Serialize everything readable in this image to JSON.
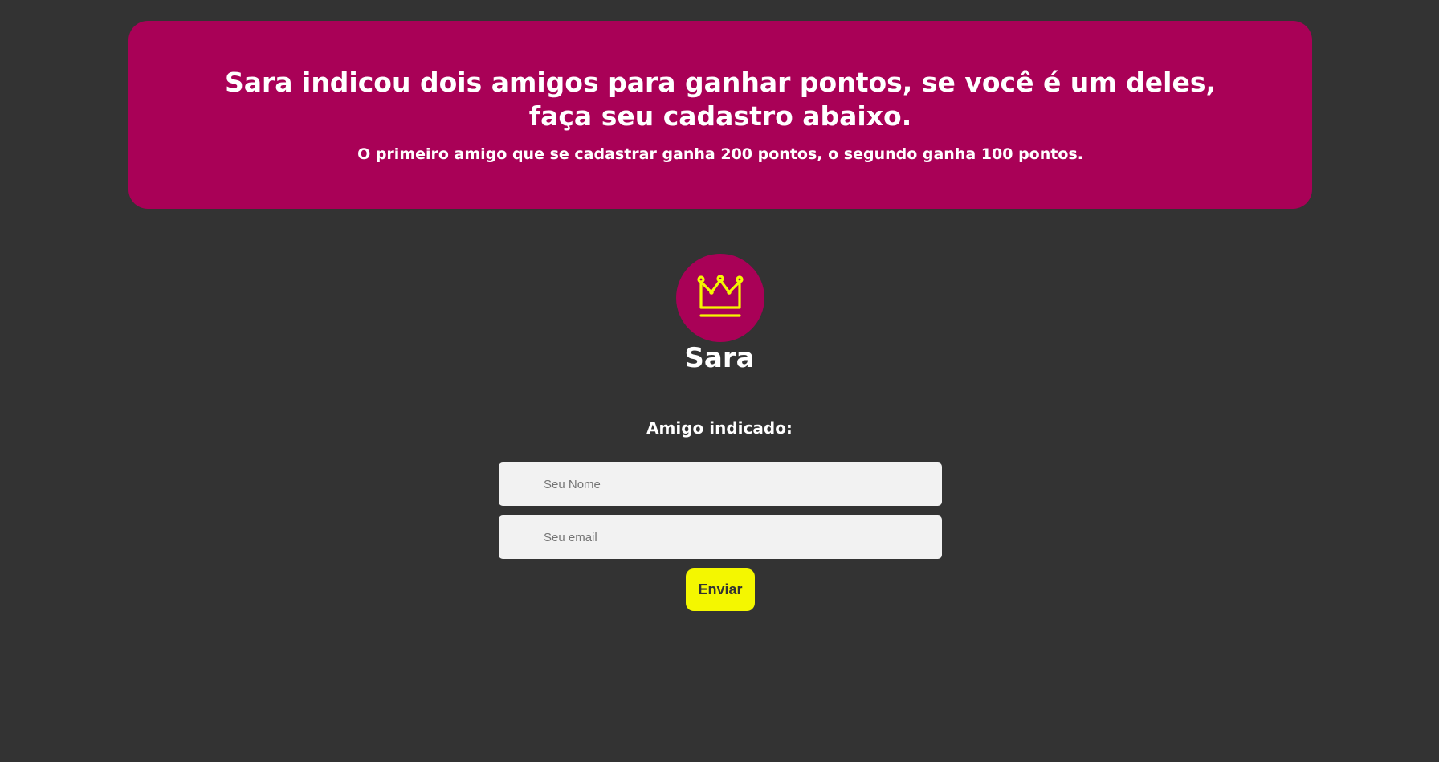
{
  "banner": {
    "title": "Sara indicou dois amigos para ganhar pontos, se você é um deles, faça seu cadastro abaixo.",
    "subtitle": "O primeiro amigo que se cadastrar ganha 200 pontos, o segundo ganha 100 pontos.",
    "background_color": "#a90157"
  },
  "profile": {
    "icon": "crown-icon",
    "icon_color": "#f4f700",
    "name": "Sara"
  },
  "form": {
    "label": "Amigo indicado:",
    "name_field": {
      "value": "",
      "placeholder": "Seu Nome"
    },
    "email_field": {
      "value": "",
      "placeholder": "Seu email"
    },
    "submit_label": "Enviar",
    "submit_color": "#f4f700"
  },
  "page": {
    "background_color": "#333333"
  }
}
